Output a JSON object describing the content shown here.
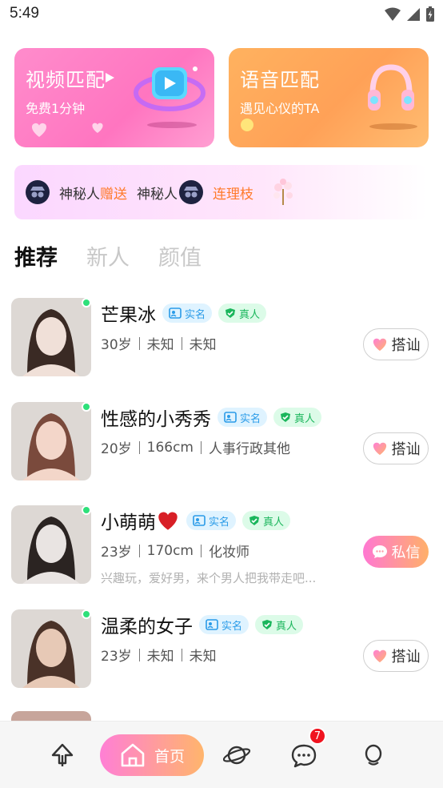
{
  "status_bar": {
    "time": "5:49"
  },
  "match_cards": {
    "video": {
      "title": "视频匹配",
      "subtitle": "免费1分钟",
      "icon": "video-camera-icon"
    },
    "voice": {
      "title": "语音匹配",
      "subtitle": "遇见心仪的TA",
      "icon": "headphones-icon"
    }
  },
  "gift_marquee": {
    "sender": "神秘人",
    "action": "赠送",
    "receiver": "神秘人",
    "gift": "连理枝"
  },
  "tabs": [
    {
      "label": "推荐",
      "active": true
    },
    {
      "label": "新人",
      "active": false
    },
    {
      "label": "颜值",
      "active": false
    }
  ],
  "badges": {
    "real_name": "实名",
    "real_person": "真人"
  },
  "users": [
    {
      "name": "芒果冰",
      "age": "30岁",
      "height": "未知",
      "job": "未知",
      "bio": "",
      "action": "搭讪",
      "action_type": "chat",
      "online": true
    },
    {
      "name": "性感的小秀秀",
      "age": "20岁",
      "height": "166cm",
      "job": "人事行政其他",
      "bio": "",
      "action": "搭讪",
      "action_type": "chat",
      "online": true
    },
    {
      "name": "小萌萌",
      "age": "23岁",
      "height": "170cm",
      "job": "化妆师",
      "bio": "兴趣玩，爱好男，来个男人把我带走吧...",
      "action": "私信",
      "action_type": "message",
      "online": true
    },
    {
      "name": "温柔的女子",
      "age": "23岁",
      "height": "未知",
      "job": "未知",
      "bio": "",
      "action": "搭讪",
      "action_type": "chat",
      "online": true
    }
  ],
  "bottom_nav": {
    "home_label": "首页",
    "message_badge": "7"
  },
  "colors": {
    "pink_accent": "#ff78d2",
    "orange_accent": "#ffb069",
    "online_green": "#2ee07a",
    "badge_red": "#f0131f"
  }
}
